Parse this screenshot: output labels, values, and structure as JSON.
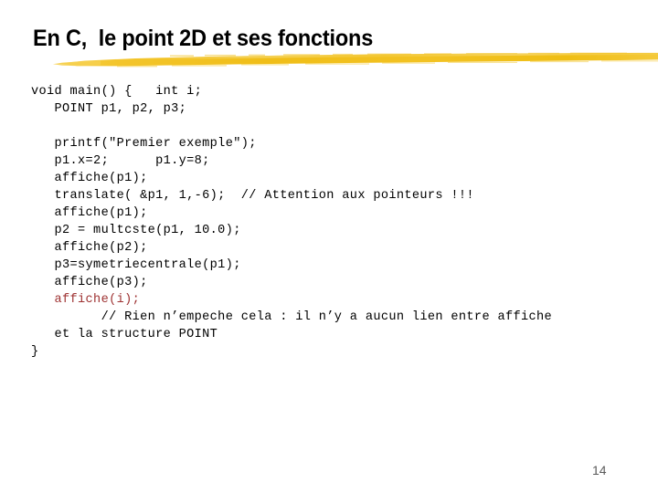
{
  "slide": {
    "title": "En C,  le point 2D et ses fonctions",
    "page_number": "14",
    "accent_color": "#F2C024",
    "code_color": "#000000",
    "highlight_color": "#9E3232",
    "background_color": "#FFFFFF"
  },
  "code": {
    "lines": [
      {
        "text": "void main() {   int i;",
        "color": "normal"
      },
      {
        "text": "   POINT p1, p2, p3;",
        "color": "normal"
      },
      {
        "text": "",
        "color": "normal"
      },
      {
        "text": "   printf(\"Premier exemple\");",
        "color": "normal"
      },
      {
        "text": "   p1.x=2;      p1.y=8;",
        "color": "normal"
      },
      {
        "text": "   affiche(p1);",
        "color": "normal"
      },
      {
        "text": "   translate( &p1, 1,-6);  // Attention aux pointeurs !!!",
        "color": "normal"
      },
      {
        "text": "   affiche(p1);",
        "color": "normal"
      },
      {
        "text": "   p2 = multcste(p1, 10.0);",
        "color": "normal"
      },
      {
        "text": "   affiche(p2);",
        "color": "normal"
      },
      {
        "text": "   p3=symetriecentrale(p1);",
        "color": "normal"
      },
      {
        "text": "   affiche(p3);",
        "color": "normal"
      },
      {
        "text": "   affiche(i);",
        "color": "red"
      },
      {
        "text": "         // Rien n’empeche cela : il n’y a aucun lien entre affiche",
        "color": "normal"
      },
      {
        "text": "   et la structure POINT",
        "color": "normal"
      },
      {
        "text": "}",
        "color": "normal"
      }
    ]
  }
}
